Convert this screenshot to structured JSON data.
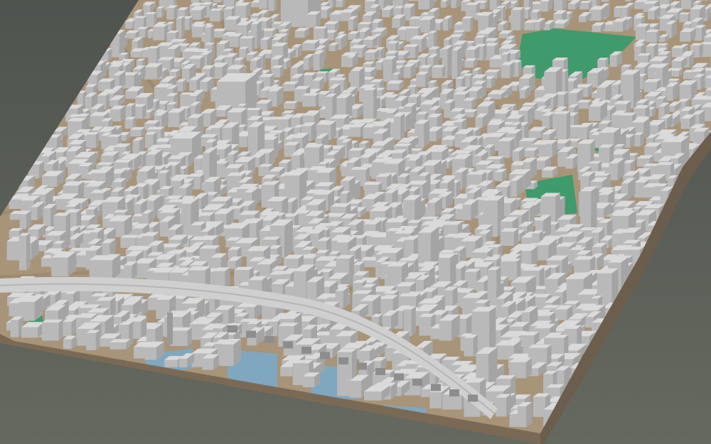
{
  "scene": {
    "kind": "3d-city-block-model",
    "palette": {
      "background_top": "#4f544f",
      "background_bottom": "#65695f",
      "building_top": "#dadada",
      "building_left": "#b9b9b9",
      "building_right": "#a4a4a4",
      "ground": "#a89478",
      "base_side": "#7a6a55",
      "park": "#3f9a6c",
      "water": "#7fa7c0",
      "rail": "#cfcfcf"
    },
    "features": {
      "parks": 8,
      "water_basins": 5,
      "rail_viaduct": 1
    }
  }
}
